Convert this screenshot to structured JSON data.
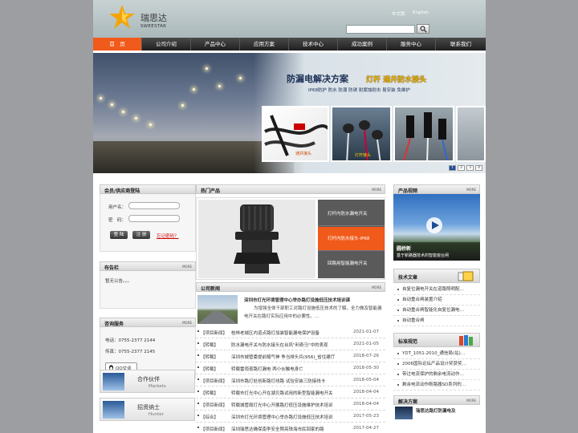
{
  "header": {
    "logo_cn": "瑞思达",
    "logo_en": "SWEESTAR",
    "lang_cn": "中文版",
    "lang_en": "English",
    "search_placeholder": "",
    "search_icon": "magnifier-icon"
  },
  "nav": {
    "items": [
      {
        "label": "首　页",
        "active": true
      },
      {
        "label": "公司介绍"
      },
      {
        "label": "产品中心"
      },
      {
        "label": "应用方案"
      },
      {
        "label": "技术中心"
      },
      {
        "label": "成功案例"
      },
      {
        "label": "服务中心"
      },
      {
        "label": "联系我们"
      }
    ]
  },
  "banner": {
    "title": "防漏电解决方案",
    "title_highlight": "灯杆 通井防水接头",
    "subtitle": "IP68防护 防水 防潮 防锈 耐腐蚀耐击 易安装 免维护",
    "photo_label_1": "通井接头",
    "photo_label_2": "灯杆接头",
    "slides": [
      "1",
      "2",
      "3",
      "4"
    ],
    "active_slide": "1"
  },
  "login": {
    "title": "会员/供应商登陆",
    "more": "",
    "username_label": "用户名：",
    "password_label": "密　码：",
    "login_button": "登 陆",
    "register_button": "注 册",
    "forgot": "忘记密码？"
  },
  "notice": {
    "title": "布告栏",
    "more": "MORE",
    "text": "暂无公告。。。"
  },
  "service": {
    "title": "咨询服务",
    "more": "MORE",
    "phone": "电话：0755-2377 2144",
    "fax": "传真：0755-2377 2145",
    "qq": "QQ交谈"
  },
  "promos": [
    {
      "cn": "合作伙伴",
      "en": "Markets"
    },
    {
      "cn": "招贤纳士",
      "en": "Hunter"
    }
  ],
  "hot_products": {
    "title": "热门产品",
    "more": "MORE",
    "items": [
      {
        "label": "灯杆内防水漏电开关"
      },
      {
        "label": "灯杆内防水接头-IP68",
        "active": true
      },
      {
        "label": "回路用智能漏电开关"
      }
    ]
  },
  "company_news": {
    "title": "公司新闻",
    "more": "MORE",
    "headline": "深圳市灯光环境管理中心举办路灯设施低压技术培训课",
    "summary": "为增强全体干部职工对路灯设施低压技术的了解，全力做及智能漏电开关在路灯实际应用中的必要性。...",
    "rows": [
      {
        "tag": "【项目新闻】",
        "title": "桂林老城区内道点路灯加装智能漏电保护设备",
        "date": "2021-01-07"
      },
      {
        "tag": "【转载】",
        "title": "防水漏电开关与防水接头在台风\"利奇马\"中的表现",
        "date": "2021-01-05"
      },
      {
        "tag": "【转载】",
        "title": "深圳市城管委提前稽气神 争当排头兵(956)_省住建厅",
        "date": "2018-07-26"
      },
      {
        "tag": "【转载】",
        "title": "转载雷雨夜路灯漏电 两小伙触电身亡",
        "date": "2018-05-30"
      },
      {
        "tag": "【项目新闻】",
        "title": "深圳市路灯处创新路灯线路 试验安装三防接线卡",
        "date": "2018-05-04"
      },
      {
        "tag": "【转载】",
        "title": "转载市灯光中心开在湖贝路试用的新型智能漏电开关",
        "date": "2018-04-04"
      },
      {
        "tag": "【项目新闻】",
        "title": "转载城管局灯光中心开展路灯低压设施维护技术培训",
        "date": "2018-04-04"
      },
      {
        "tag": "【综合】",
        "title": "深圳市灯光环境管理中心举办路灯设施低压技术培训",
        "date": "2017-05-23"
      },
      {
        "tag": "【项目新闻】",
        "title": "深圳瑞思达确保南李安全照亮珠海市民回家的路",
        "date": "2017-04-27"
      }
    ]
  },
  "video": {
    "title": "产品视频",
    "more": "MORE",
    "caption_title": "圆桥新",
    "caption": "基于新路器技术的智能窗台闸"
  },
  "tech": {
    "title": "技术文章",
    "items": [
      "自复位漏电开关在道路照明配…",
      "自动重合闸装置介绍",
      "自动重合闸智能化自复位漏电…",
      "自动重合闸"
    ]
  },
  "standards": {
    "title": "标准规范",
    "items": [
      "YDT_1051-2010_通信局(站)…",
      "2006国际论坛产品设计奖获奖…",
      "带过电流保护的剩余电流动作…",
      "剩余电流动作断路器SD系列的…"
    ]
  },
  "solutions": {
    "title": "解决方案",
    "more": "MORE",
    "item": "瑞思达路灯防漏电及"
  },
  "colors": {
    "accent": "#f05a1a",
    "nav_bg": "#2a2a2a",
    "page_bg": "#9c9ea2"
  }
}
